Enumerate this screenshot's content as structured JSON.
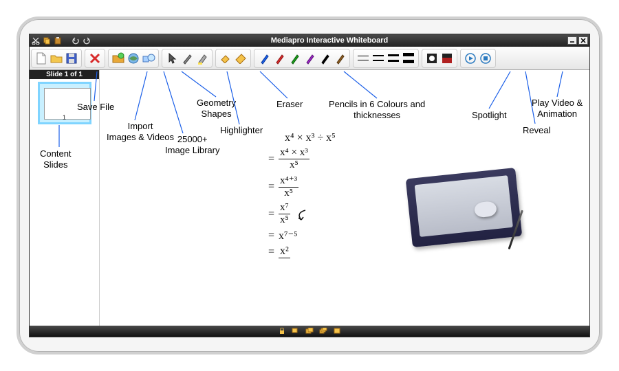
{
  "window": {
    "title": "Mediapro Interactive Whiteboard"
  },
  "sidebar": {
    "header": "Slide 1 of 1",
    "slide_number": "1"
  },
  "annotations": {
    "content_slides": "Content\nSlides",
    "save_file": "Save File",
    "import": "Import\nImages & Videos",
    "library": "25000+\nImage Library",
    "geometry": "Geometry\nShapes",
    "highlighter": "Highlighter",
    "eraser": "Eraser",
    "pencils": "Pencils in 6 Colours and\nthicknesses",
    "spotlight": "Spotlight",
    "reveal": "Reveal",
    "play": "Play Video &\nAnimation"
  },
  "math": {
    "line1": "x⁴ × x³ ÷ x⁵",
    "line2_num": "x⁴ × x³",
    "line2_den": "x⁵",
    "line3_num": "x⁴⁺³",
    "line3_den": "x⁵",
    "line4_num": "x⁷",
    "line4_den": "x⁵",
    "line5": "x⁷⁻⁵",
    "line6": "x²"
  },
  "titlebar_icons": [
    "cut",
    "copy",
    "paste",
    "undo",
    "redo"
  ],
  "pencil_colors": [
    "#1b5fe8",
    "#d82c2c",
    "#1aa01a",
    "#9a26c4",
    "#000000",
    "#8a5a20"
  ],
  "line_weights": [
    1,
    2,
    3,
    5
  ]
}
